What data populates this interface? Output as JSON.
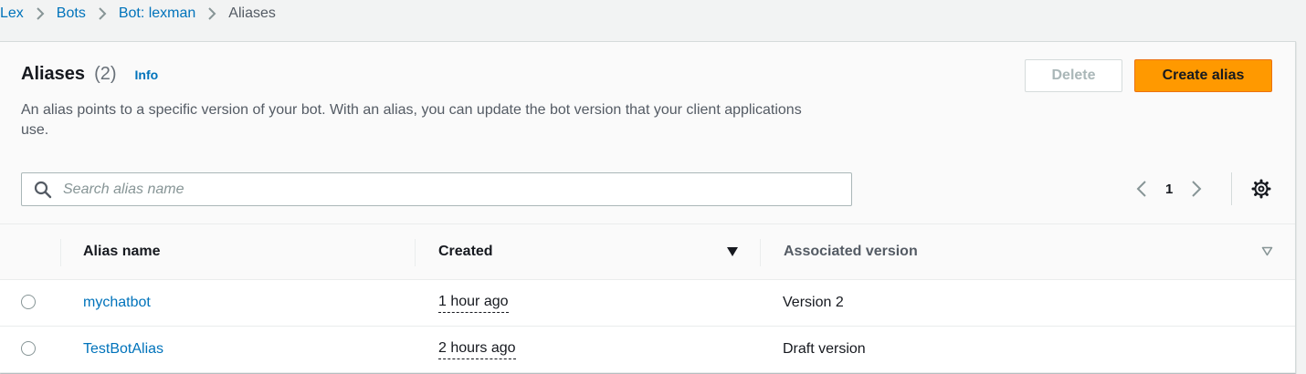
{
  "breadcrumb": {
    "items": [
      {
        "label": "Lex"
      },
      {
        "label": "Bots"
      },
      {
        "label": "Bot: lexman"
      }
    ],
    "current": "Aliases"
  },
  "header": {
    "title": "Aliases",
    "count": "(2)",
    "info_label": "Info",
    "description": "An alias points to a specific version of your bot. With an alias, you can update the bot version that your client applications use.",
    "delete_label": "Delete",
    "create_label": "Create alias"
  },
  "search": {
    "placeholder": "Search alias name",
    "value": ""
  },
  "pagination": {
    "current_page": "1"
  },
  "table": {
    "columns": [
      "Alias name",
      "Created",
      "Associated version"
    ],
    "rows": [
      {
        "alias_name": "mychatbot",
        "created": "1 hour ago",
        "version": "Version 2"
      },
      {
        "alias_name": "TestBotAlias",
        "created": "2 hours ago",
        "version": "Draft version"
      }
    ]
  },
  "colors": {
    "link": "#0073bb",
    "primary_button": "#ff9900",
    "background": "#f2f3f3"
  },
  "icons": [
    "chevron-right-icon",
    "search-icon",
    "chevron-left-icon",
    "settings-gear-icon",
    "sort-descending-icon",
    "sort-caret-icon"
  ]
}
